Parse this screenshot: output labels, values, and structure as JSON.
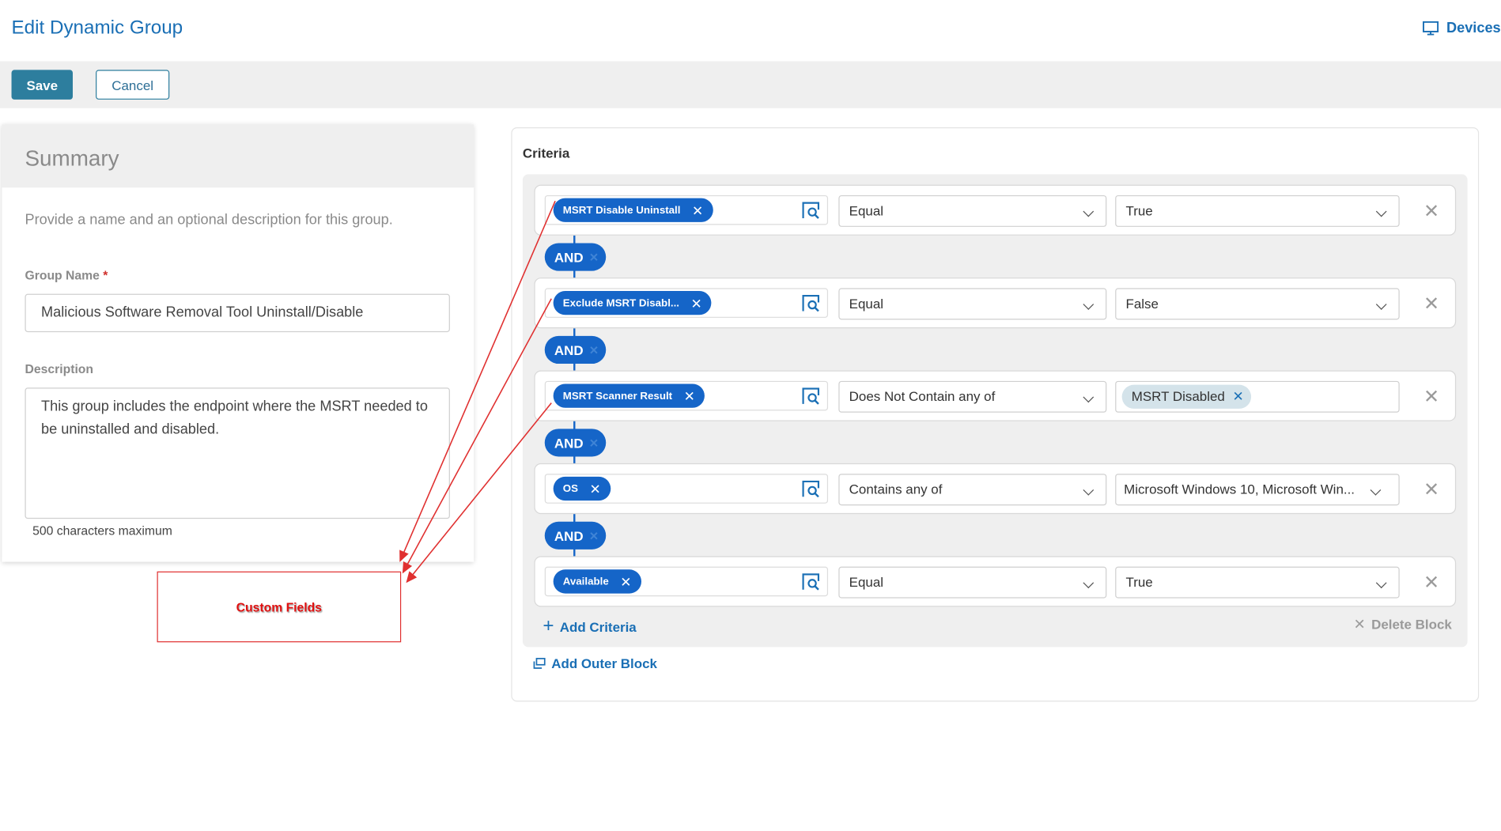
{
  "header": {
    "title": "Edit Dynamic Group",
    "devices_label": "Devices"
  },
  "toolbar": {
    "save_label": "Save",
    "cancel_label": "Cancel"
  },
  "summary": {
    "title": "Summary",
    "description": "Provide a name and an optional description for this group.",
    "group_name_label": "Group Name",
    "required_mark": "*",
    "group_name_value": "Malicious Software Removal Tool Uninstall/Disable",
    "description_label": "Description",
    "description_value": "This group includes the endpoint where the MSRT needed to be uninstalled and disabled.",
    "char_hint": "500 characters maximum"
  },
  "annotation": {
    "label": "Custom Fields",
    "color": "#e01010"
  },
  "criteria": {
    "title": "Criteria",
    "connector": "AND",
    "rows": [
      {
        "field": "MSRT Disable Uninstall",
        "operator": "Equal",
        "value": "True"
      },
      {
        "field": "Exclude MSRT Disabl...",
        "operator": "Equal",
        "value": "False"
      },
      {
        "field": "MSRT Scanner Result",
        "operator": "Does Not Contain any of",
        "value_tag": "MSRT Disabled"
      },
      {
        "field": "OS",
        "operator": "Contains any of",
        "value": "Microsoft Windows 10, Microsoft Win..."
      },
      {
        "field": "Available",
        "operator": "Equal",
        "value": "True"
      }
    ],
    "add_criteria_label": "Add Criteria",
    "delete_block_label": "Delete Block",
    "add_outer_block_label": "Add Outer Block"
  },
  "colors": {
    "brand_blue": "#1a6fb5",
    "pill_blue": "#1565c8",
    "save_teal": "#2d7e9e",
    "arrow_red": "#e03030"
  }
}
